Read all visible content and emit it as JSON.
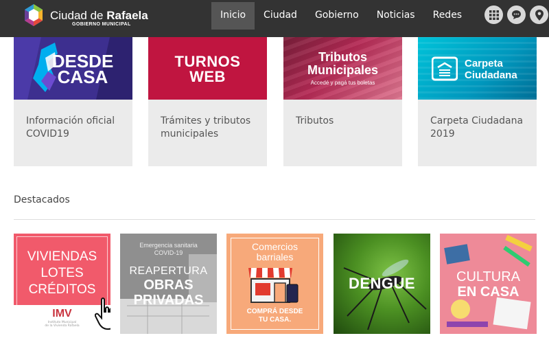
{
  "header": {
    "logo_name": "Ciudad de",
    "logo_name_bold": "Rafaela",
    "logo_sub": "GOBIERNO MUNICIPAL",
    "nav": [
      "Inicio",
      "Ciudad",
      "Gobierno",
      "Noticias",
      "Redes"
    ],
    "active_nav": "Inicio",
    "icons": [
      "apps-grid-icon",
      "chat-bubble-icon",
      "map-pin-icon"
    ]
  },
  "cards": [
    {
      "banner_line1": "DESDE",
      "banner_line2": "CASA",
      "label": "Información oficial COVID19",
      "color": "#3d2f8f"
    },
    {
      "banner_line1": "TURNOS",
      "banner_line2": "WEB",
      "label": "Trámites y tributos municipales",
      "color": "#c01540"
    },
    {
      "banner_line1": "Tributos",
      "banner_line2": "Municipales",
      "banner_sub": "Accedé y pagá tus boletas",
      "label": "Tributos",
      "color": "#b52a55"
    },
    {
      "banner_line1": "Carpeta",
      "banner_line2": "Ciudadana",
      "label": "Carpeta Ciudadana 2019",
      "color": "#00a7c8"
    }
  ],
  "destacados": {
    "title": "Destacados",
    "tiles": [
      {
        "lines": [
          "VIVIENDAS",
          "LOTES",
          "CRÉDITOS"
        ],
        "logo": "IMV",
        "logo_sub1": "Instituto Municipal",
        "logo_sub2": "de la Vivienda Rafaela",
        "color": "#f15a6b"
      },
      {
        "top1": "Emergencia sanitaria",
        "top2": "COVID-19",
        "mid": "REAPERTURA",
        "line1": "OBRAS",
        "line2": "PRIVADAS"
      },
      {
        "top1": "Comercios",
        "top2": "barriales",
        "bottom1": "COMPRÁ DESDE",
        "bottom2": "TU CASA.",
        "color": "#f7a97a"
      },
      {
        "label": "DENGUE",
        "color": "#3e7a1e"
      },
      {
        "line1": "CULTURA",
        "line2": "EN CASA",
        "color": "#e97a8c"
      }
    ]
  }
}
